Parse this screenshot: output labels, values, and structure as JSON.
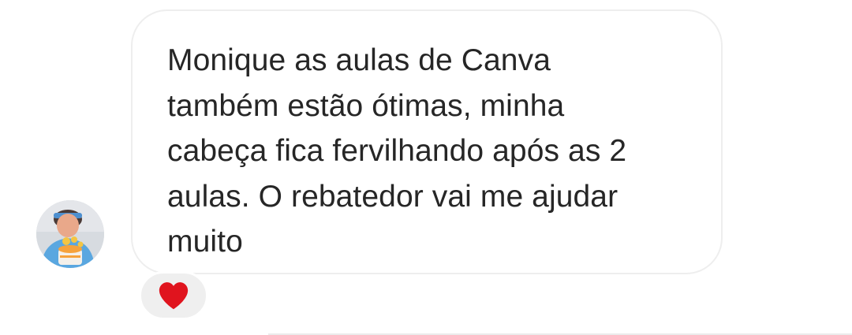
{
  "message": {
    "text": "Monique as aulas de Canva\ntambém estão ótimas, minha\ncabeça fica fervilhando após as 2\naulas. O rebatedor vai me ajudar\nmuito"
  },
  "reaction": {
    "icon": "heart-icon",
    "color": "#ED4956"
  },
  "avatar": {
    "icon": "user-avatar"
  },
  "colors": {
    "text": "#262626",
    "bubble_border": "#EEEEEE",
    "reaction_bg": "#EFEFEF"
  }
}
